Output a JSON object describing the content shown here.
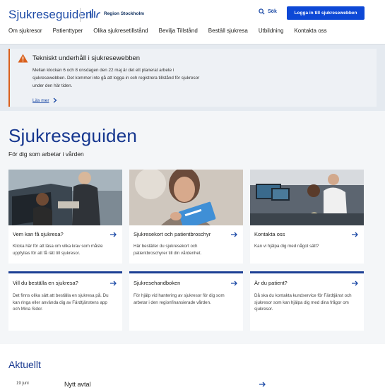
{
  "header": {
    "brand": "Sjukreseguiden",
    "region": "Region Stockholm",
    "search_label": "Sök",
    "login_label": "Logga in till sjukresewebben"
  },
  "nav": [
    "Om sjukresor",
    "Patienttyper",
    "Olika sjukresetillstånd",
    "Bevilja Tillstånd",
    "Beställ sjukresa",
    "Utbildning",
    "Kontakta oss"
  ],
  "alert": {
    "title": "Tekniskt underhåll i sjukresewebben",
    "body": "Mellan klockan 6 och 8 onsdagen den 22 maj är det ett planerat arbete i sjukresewebben. Det kommer inte gå att logga in och registrera tillstånd för sjukresor under den här tiden.",
    "link": "Läs mer"
  },
  "hero": {
    "title": "Sjukreseguiden",
    "subtitle": "För dig som arbetar i vården"
  },
  "cards": [
    {
      "title": "Vem kan få sjukresa?",
      "text": "Klicka här för att läsa om vilka krav som måste uppfyllas för att få rätt till sjukresor."
    },
    {
      "title": "Sjukresekort och patientbroschyr",
      "text": "Här beställer du sjukresekort och patientbroschyrer till din vårdenhet."
    },
    {
      "title": "Kontakta oss",
      "text": "Kan vi hjälpa dig med något sätt?"
    },
    {
      "title": "Vill du beställa en sjukresa?",
      "text": "Det finns olika sätt att beställa en sjukresa på. Du kan ringa eller använda dig av Färdtjänstens app och Mina Sidor."
    },
    {
      "title": "Sjukresehandboken",
      "text": "För hjälp vid hantering av sjukresor för dig som arbetar i den regionfinansierade vården."
    },
    {
      "title": "Är du patient?",
      "text": "Då ska du kontakta kundservice för Färdtjänst och sjukresor som kan hjälpa dig med dina frågor om sjukresor."
    }
  ],
  "news": {
    "title": "Aktuellt",
    "items": [
      {
        "date": "19 juni",
        "title": "Nytt avtal"
      }
    ]
  },
  "colors": {
    "brand": "#1c4aa6",
    "button": "#0d48d6",
    "warning": "#d9601c",
    "card_bar": "#1c3f94"
  }
}
